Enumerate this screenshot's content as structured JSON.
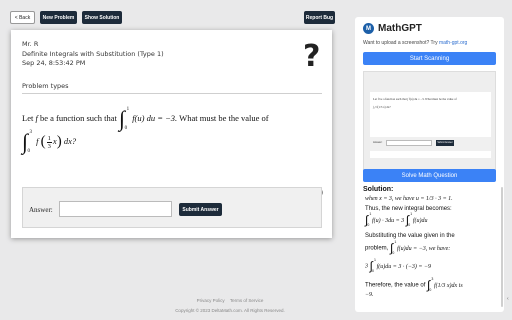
{
  "toolbar": {
    "back_label": "< Back",
    "new_problem_label": "New Problem",
    "show_solution_label": "Show Solution",
    "report_bug_label": "Report Bug"
  },
  "problem": {
    "teacher": "Mr. R",
    "title": "Definite Integrals with Substitution (Type 1)",
    "date": "Sep 24, 8:53:42 PM",
    "problem_types_label": "Problem types",
    "help_symbol": "?",
    "question_line1_text_a": "Let",
    "question_line1_var": "f",
    "question_line1_text_b": "be a function such that",
    "int1_upper": "1",
    "int1_lower": "0",
    "int1_body": "f(u) du = −3.",
    "question_line1_text_c": "What must be the value of",
    "int2_upper": "3",
    "int2_lower": "0",
    "int2_f": "f",
    "int2_frac_num": "1",
    "int2_frac_den": "3",
    "int2_var": "x",
    "int2_tail": "dx?"
  },
  "answer": {
    "label": "Answer:",
    "value": "",
    "submit_label": "Submit Answer"
  },
  "footer": {
    "privacy": "Privacy Policy",
    "terms": "Terms of Service",
    "copyright": "Copyright © 2023 DeltaMath.com. All Rights Reserved."
  },
  "sidebar": {
    "brand": "MathGPT",
    "logo_letter": "M",
    "upload_prompt": "Want to upload a screenshot? Try",
    "upload_link": "math-gpt.org",
    "start_scanning_label": "Start Scanning",
    "solve_label": "Solve Math Question",
    "solution_heading": "Solution:",
    "thumb_text": "Let f be a function such that ∫ f(u) du = −3. What must be the value of",
    "thumb_integral": "∫₀³ f(1/3 x) dx?",
    "thumb_answer_label": "Answer:",
    "thumb_submit": "Submit Answer",
    "solution": {
      "l1": "when x = 3, we have u = 1/3 · 3 = 1.",
      "l2": "Thus, the new integral becomes:",
      "l3": "f(u) · 3du = 3",
      "l3b": "f(u)du",
      "l4": "Substituting the value given in the",
      "l5a": "problem,",
      "l5b": "f(u)du = −3, we have:",
      "l6a": "3",
      "l6b": "f(u)du = 3 · (−3) = −9",
      "l7a": "Therefore, the value of",
      "l7b": "f(1/3 x)dx is",
      "l8": "−9."
    }
  },
  "colors": {
    "primary_dark": "#1d2b3a",
    "accent_blue": "#3b82f6",
    "background": "#e9e9ea"
  }
}
